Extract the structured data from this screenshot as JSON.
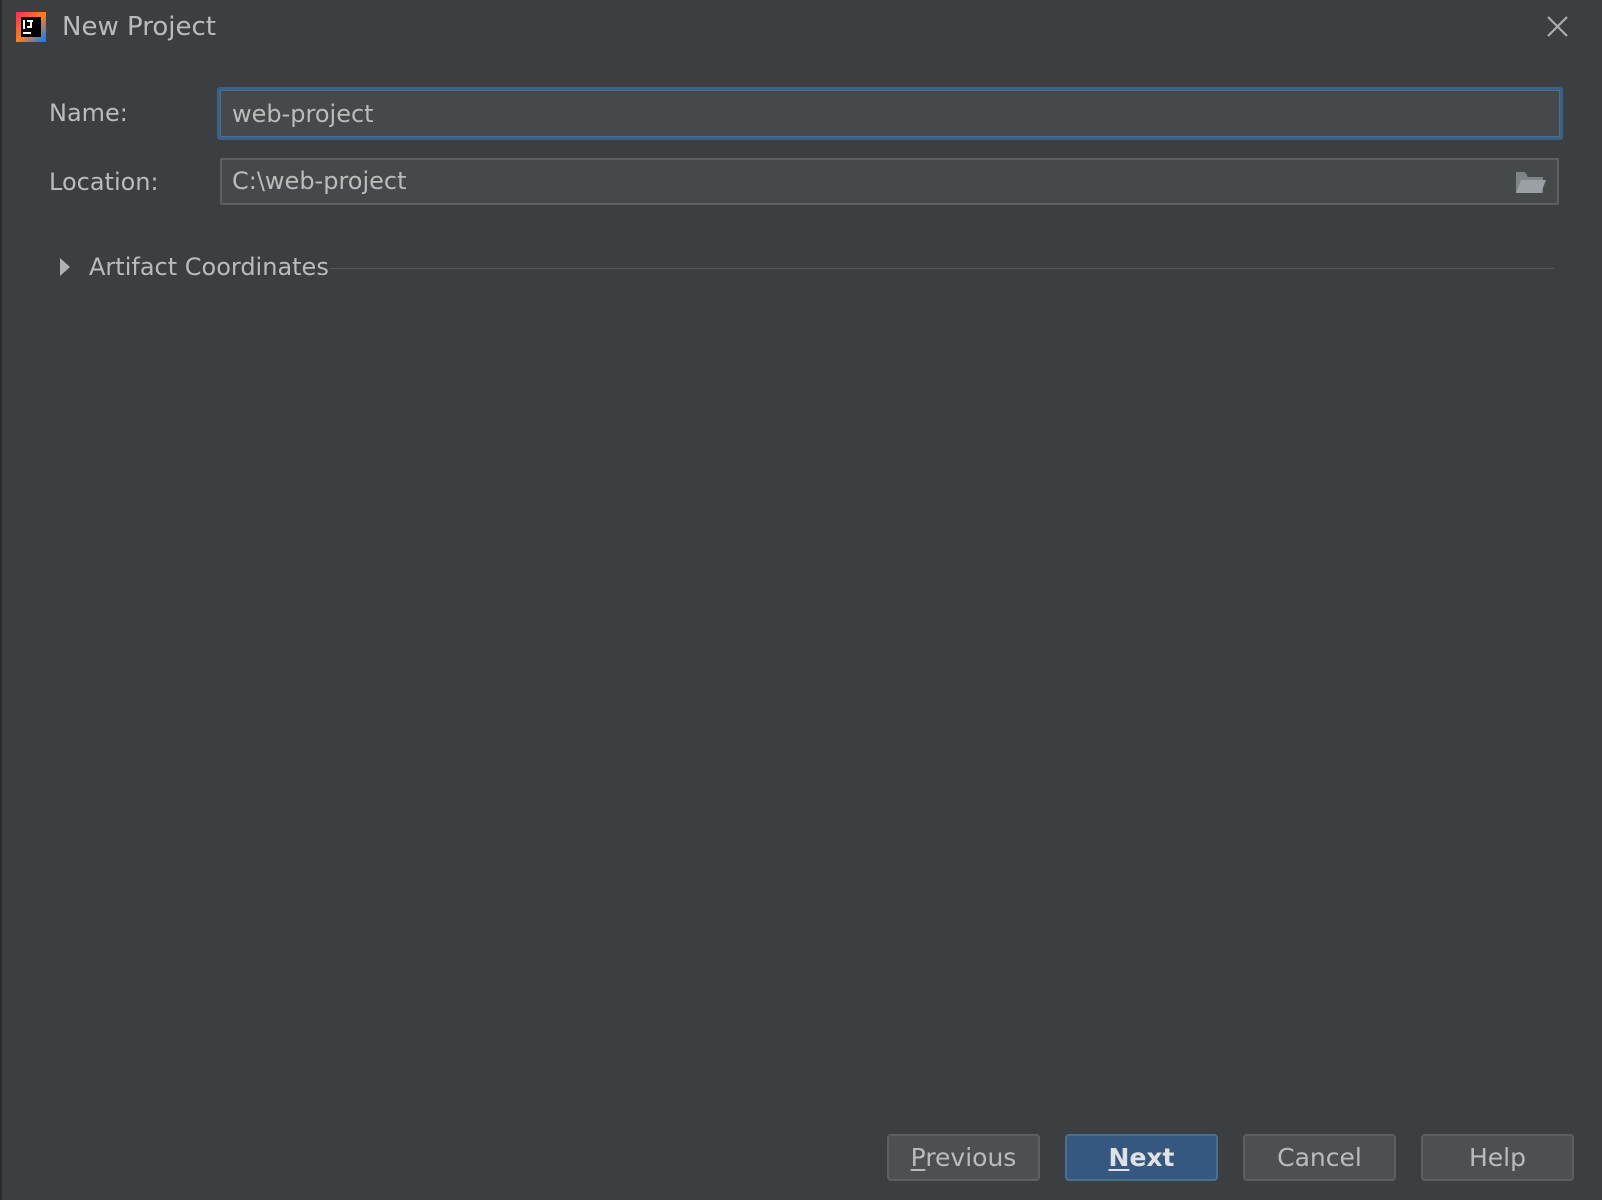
{
  "window": {
    "title": "New Project",
    "app_icon": "intellij-idea-icon",
    "close_icon": "close-icon"
  },
  "form": {
    "name_label": "Name:",
    "name_value": "web-project",
    "location_label": "Location:",
    "location_value": "C:\\web-project",
    "browse_icon": "folder-open-icon"
  },
  "section": {
    "title": "Artifact Coordinates",
    "expanded": false,
    "arrow_icon": "expand-arrow-icon"
  },
  "buttons": {
    "previous_mnemonic": "P",
    "previous_rest": "revious",
    "next_mnemonic": "N",
    "next_rest": "ext",
    "cancel": "Cancel",
    "help": "Help"
  },
  "colors": {
    "background": "#3c3f41",
    "field_background": "#45494a",
    "focus_border": "#3d6185",
    "primary_button": "#365880",
    "text": "#bbbbbb"
  }
}
